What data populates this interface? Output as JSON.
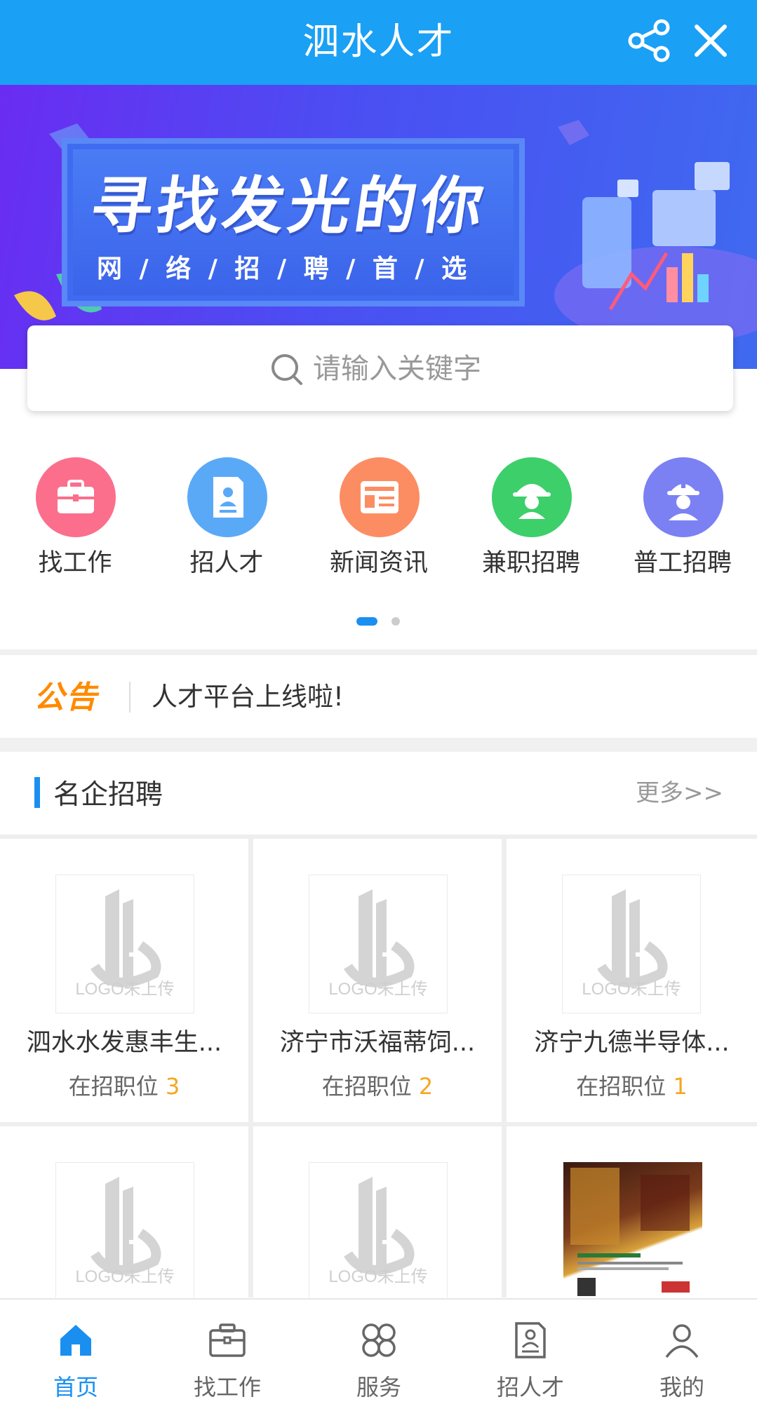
{
  "header": {
    "title": "泗水人才",
    "share_icon": "share-icon",
    "close_icon": "close-icon",
    "bg_color": "#1aa0f5"
  },
  "banner": {
    "headline": "寻找发光的你",
    "subline": "网 / 络 / 招 / 聘 / 首 / 选"
  },
  "search": {
    "placeholder": "请输入关键字"
  },
  "quick_nav": [
    {
      "label": "找工作",
      "icon": "briefcase-icon",
      "color": "#fb6f8c"
    },
    {
      "label": "招人才",
      "icon": "resume-icon",
      "color": "#5aa9f7"
    },
    {
      "label": "新闻资讯",
      "icon": "news-icon",
      "color": "#fc8d62"
    },
    {
      "label": "兼职招聘",
      "icon": "worker-cap-icon",
      "color": "#3ccf6a"
    },
    {
      "label": "普工招聘",
      "icon": "hardhat-worker-icon",
      "color": "#7b80f3"
    }
  ],
  "carousel": {
    "pages": 2,
    "active": 1
  },
  "notice": {
    "badge": "公告",
    "text": "人才平台上线啦!"
  },
  "section": {
    "title": "名企招聘",
    "more": "更多>>"
  },
  "companies": [
    {
      "name": "泗水水发惠丰生...",
      "count_label": "在招职位",
      "count": "3",
      "logo_text": "LOGO未上传"
    },
    {
      "name": "济宁市沃福蒂饲...",
      "count_label": "在招职位",
      "count": "2",
      "logo_text": "LOGO未上传"
    },
    {
      "name": "济宁九德半导体...",
      "count_label": "在招职位",
      "count": "1",
      "logo_text": "LOGO未上传"
    },
    {
      "name": "",
      "count_label": "",
      "count": "",
      "logo_text": "LOGO未上传"
    },
    {
      "name": "",
      "count_label": "",
      "count": "",
      "logo_text": "LOGO未上传"
    },
    {
      "name": "",
      "count_label": "",
      "count": "",
      "logo_text": ""
    }
  ],
  "tabbar": [
    {
      "label": "首页",
      "icon": "home-icon",
      "active": true
    },
    {
      "label": "找工作",
      "icon": "briefcase-icon",
      "active": false
    },
    {
      "label": "服务",
      "icon": "service-grid-icon",
      "active": false
    },
    {
      "label": "招人才",
      "icon": "resume-icon",
      "active": false
    },
    {
      "label": "我的",
      "icon": "user-icon",
      "active": false
    }
  ],
  "colors": {
    "accent": "#1a8ff0",
    "count_highlight": "#f5a623",
    "notice_badge": "#ff8a00"
  }
}
